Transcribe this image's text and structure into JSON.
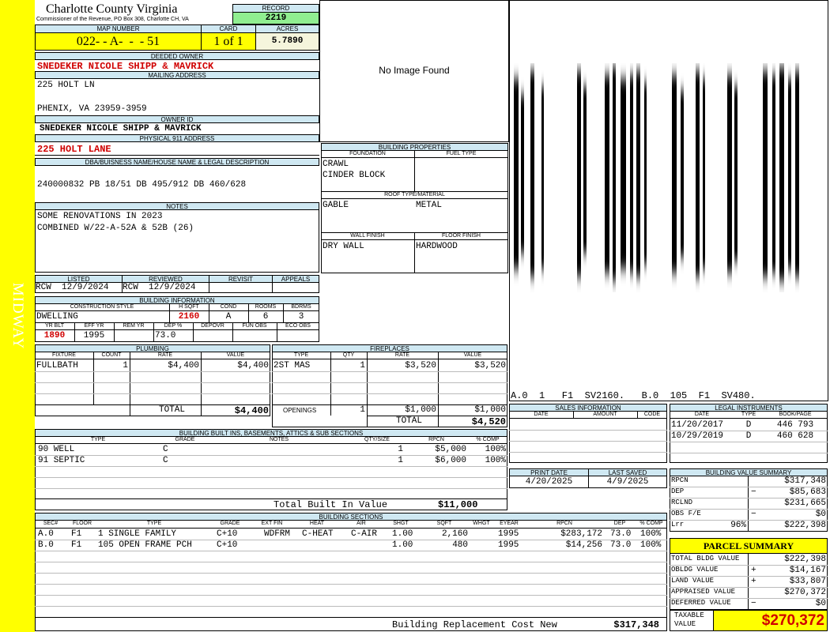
{
  "side_label": "MIDWAY",
  "header": {
    "county": "Charlotte County Virginia",
    "commissioner": "Commissioner of the Revenue, PO Box 308, Charlotte CH, VA",
    "record_label": "RECORD",
    "record": "2219",
    "map_label": "MAP NUMBER",
    "map": "022- - A-  -  - 51",
    "card_label": "CARD",
    "card": "1 of 1",
    "acres_label": "ACRES",
    "acres": "5.7890"
  },
  "owner": {
    "deeded_label": "DEEDED OWNER",
    "deeded": "SNEDEKER NICOLE SHIPP & MAVRICK",
    "mailing_label": "MAILING ADDRESS",
    "mail1": "225 HOLT LN",
    "mail2": "PHENIX, VA 23959-3959",
    "owner_id_label": "OWNER ID",
    "owner_id": "SNEDEKER NICOLE SHIPP & MAVRICK",
    "phys_label": "PHYSICAL 911 ADDRESS",
    "phys": "225 HOLT LANE"
  },
  "legal": {
    "label": "DBA/BUISNESS NAME/HOUSE NAME & LEGAL DESCRIPTION",
    "text": "240000832 PB 18/51 DB 495/912 DB 460/628"
  },
  "notes": {
    "label": "NOTES",
    "line1": "SOME RENOVATIONS IN 2023",
    "line2": "COMBINED W/22-A-52A & 52B (26)"
  },
  "review": {
    "listed_label": "LISTED",
    "reviewed_label": "REVIEWED",
    "revisit_label": "REVISIT",
    "appeals_label": "APPEALS",
    "listed": "RCW  12/9/2024",
    "reviewed": "RCW  12/9/2024"
  },
  "building_info": {
    "label": "BUILDING INFORMATION",
    "cs_label": "CONSTRUCTION STYLE",
    "hsqft_label": "H SQFT",
    "cond_label": "COND",
    "rooms_label": "ROOMS",
    "bdrms_label": "BDRMS",
    "style": "DWELLING",
    "hsqft": "2160",
    "cond": "A",
    "rooms": "6",
    "bdrms": "3",
    "yrblt_label": "YR BLT",
    "effyr_label": "EFF YR",
    "remyr_label": "REM YR",
    "dep_label": "DEP %",
    "depovr_label": "DEPOVR",
    "funobs_label": "FUN OBS",
    "ecoobs_label": "ECO OBS",
    "yrblt": "1890",
    "effyr": "1995",
    "dep": "73.0"
  },
  "image": {
    "text": "No Image Found"
  },
  "props": {
    "label": "BUILDING PROPERTIES",
    "foundation_label": "FOUNDATION",
    "fuel_label": "FUEL TYPE",
    "f1": "CRAWL",
    "f2": "CINDER BLOCK",
    "roof_label": "ROOF TYPE/MATERIAL",
    "roof1": "GABLE",
    "roof2": "METAL",
    "wall_label": "WALL FINISH",
    "floor_label": "FLOOR FINISH",
    "wall": "DRY WALL",
    "floor": "HARDWOOD"
  },
  "sketch": {
    "caption": "A.0  1   F1  SV2160.   B.0  105  F1  SV480."
  },
  "plumbing": {
    "label": "PLUMBING",
    "h": [
      "FIXTURE",
      "COUNT",
      "RATE",
      "VALUE"
    ],
    "row": [
      "FULLBATH",
      "1",
      "$4,400",
      "$4,400"
    ],
    "total_label": "TOTAL",
    "total": "$4,400"
  },
  "fireplaces": {
    "label": "FIREPLACES",
    "h": [
      "TYPE",
      "QTY",
      "RATE",
      "VALUE"
    ],
    "row": [
      "2ST MAS",
      "1",
      "$3,520",
      "$3,520"
    ],
    "openings_label": "OPENINGS",
    "openings": [
      "1",
      "$1,000",
      "$1,000"
    ],
    "total_label": "TOTAL",
    "total": "$4,520"
  },
  "sales": {
    "label": "SALES INFORMATION",
    "h": [
      "DATE",
      "AMOUNT",
      "CODE"
    ]
  },
  "legal_inst": {
    "label": "LEGAL INSTRUMENTS",
    "h": [
      "DATE",
      "TYPE",
      "BOOK/PAGE"
    ],
    "rows": [
      [
        "11/20/2017",
        "D",
        "446 793"
      ],
      [
        "10/29/2019",
        "D",
        "460 628"
      ]
    ]
  },
  "dates": {
    "print_label": "PRINT DATE",
    "saved_label": "LAST SAVED",
    "print": "4/20/2025",
    "saved": "4/9/2025"
  },
  "builtins": {
    "label": "BUILDING BUILT INS, BASEMENTS, ATTICS & SUB SECTIONS",
    "h": [
      "TYPE",
      "GRADE",
      "NOTES",
      "QTY/SIZE",
      "RPCN",
      "% COMP"
    ],
    "rows": [
      [
        "90 WELL",
        "C",
        "1",
        "$5,000",
        "100%"
      ],
      [
        "91 SEPTIC",
        "C",
        "1",
        "$6,000",
        "100%"
      ]
    ],
    "total_label": "Total Built In Value",
    "total": "$11,000"
  },
  "bvs": {
    "label": "BUILDING VALUE SUMMARY",
    "rows": [
      [
        "RPCN",
        "",
        "$317,348"
      ],
      [
        "DEP",
        "−",
        "$85,683"
      ],
      [
        "RCLND",
        "",
        "$231,665"
      ],
      [
        "OBS F/E",
        "−",
        "$0"
      ],
      [
        "Lrr",
        "96%",
        "$222,398"
      ]
    ]
  },
  "parcel": {
    "label": "PARCEL SUMMARY",
    "rows": [
      [
        "TOTAL BLDG VALUE",
        "",
        "$222,398"
      ],
      [
        "OBLDG VALUE",
        "+",
        "$14,167"
      ],
      [
        "LAND VALUE",
        "+",
        "$33,807"
      ],
      [
        "APPRAISED VALUE",
        "",
        "$270,372"
      ],
      [
        "DEFERRED VALUE",
        "−",
        "$0"
      ]
    ],
    "taxable_label1": "TAXABLE",
    "taxable_label2": "VALUE",
    "taxable": "$270,372"
  },
  "sections": {
    "label": "BUILDING SECTIONS",
    "h": [
      "SEC#",
      "FLOOR",
      "TYPE",
      "GRADE",
      "EXT FIN",
      "HEAT",
      "AIR",
      "SHGT",
      "SQFT",
      "WHGT",
      "EYEAR",
      "RPCN",
      "DEP",
      "% COMP"
    ],
    "rows": [
      [
        "A.0",
        "F1",
        "1 SINGLE FAMILY",
        "C+10",
        "WDFRM",
        "C-HEAT",
        "C-AIR",
        "1.00",
        "2,160",
        "",
        "1995",
        "$283,172",
        "73.0",
        "100%"
      ],
      [
        "B.0",
        "F1",
        "105 OPEN FRAME PCH",
        "C+10",
        "",
        "",
        "",
        "1.00",
        "480",
        "",
        "1995",
        "$14,256",
        "73.0",
        "100%"
      ]
    ],
    "total_label": "Building Replacement Cost New",
    "total": "$317,348"
  },
  "colors": {
    "side": "#ffff00",
    "header_bg": "#cfe8f2",
    "record_bg": "#90ee90",
    "acres_bg": "#f5f5dc",
    "red": "#d00000"
  }
}
